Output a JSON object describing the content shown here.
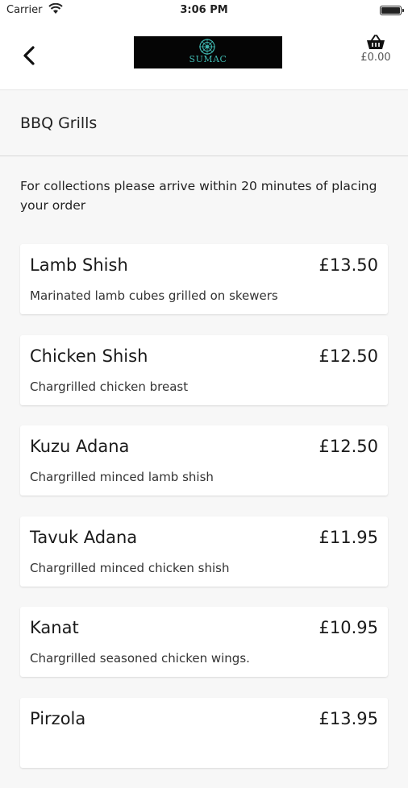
{
  "status_bar": {
    "carrier": "Carrier",
    "time": "3:06 PM"
  },
  "header": {
    "logo_text": "SUMAC",
    "basket_total": "£0.00"
  },
  "category": {
    "title": "BBQ Grills",
    "notice": "For collections please arrive within 20 minutes of placing your order"
  },
  "menu": {
    "items": [
      {
        "name": "Lamb Shish",
        "price": "£13.50",
        "description": "Marinated lamb cubes grilled on skewers"
      },
      {
        "name": "Chicken Shish",
        "price": "£12.50",
        "description": "Chargrilled chicken breast"
      },
      {
        "name": "Kuzu Adana",
        "price": "£12.50",
        "description": "Chargrilled minced lamb shish"
      },
      {
        "name": "Tavuk Adana",
        "price": "£11.95",
        "description": "Chargrilled minced chicken shish"
      },
      {
        "name": "Kanat",
        "price": "£10.95",
        "description": "Chargrilled seasoned chicken wings."
      },
      {
        "name": "Pirzola",
        "price": "£13.95",
        "description": ""
      }
    ]
  },
  "colors": {
    "logo_accent": "#3fb8b0",
    "background": "#f7f7f7",
    "card": "#ffffff"
  }
}
